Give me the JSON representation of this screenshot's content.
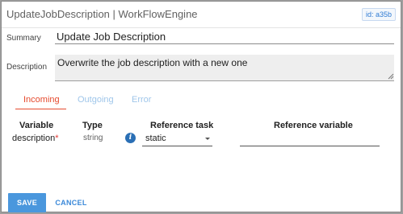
{
  "dialog": {
    "title": "UpdateJobDescription | WorkFlowEngine",
    "id_badge": "id: a35b"
  },
  "form": {
    "summary_label": "Summary",
    "summary_value": "Update Job Description",
    "description_label": "Description",
    "description_value": "Overwrite the job description with a new one"
  },
  "tabs": [
    {
      "label": "Incoming",
      "active": true
    },
    {
      "label": "Outgoing",
      "active": false
    },
    {
      "label": "Error",
      "active": false
    }
  ],
  "table": {
    "headers": {
      "variable": "Variable",
      "type": "Type",
      "reference_task": "Reference task",
      "reference_variable": "Reference variable"
    },
    "rows": [
      {
        "variable": "description",
        "required_mark": "*",
        "type": "string",
        "info_icon": "info-icon",
        "reference_task": "static",
        "reference_variable": ""
      }
    ]
  },
  "footer": {
    "save_label": "SAVE",
    "cancel_label": "CANCEL"
  },
  "colors": {
    "accent_blue": "#4a97dd",
    "active_tab": "#e64a2e",
    "inactive_tab": "#9fc6ea",
    "required": "#e53935",
    "info_icon": "#2a6fb5"
  }
}
